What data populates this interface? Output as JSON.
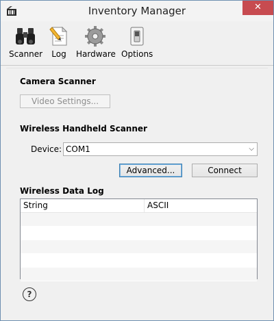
{
  "window": {
    "title": "Inventory Manager",
    "close_label": "✕"
  },
  "toolbar": {
    "scanner": "Scanner",
    "log": "Log",
    "hardware": "Hardware",
    "options": "Options"
  },
  "camera": {
    "title": "Camera Scanner",
    "video_settings": "Video Settings..."
  },
  "wireless": {
    "title": "Wireless Handheld Scanner",
    "device_label": "Device:",
    "device_value": "COM1",
    "advanced": "Advanced...",
    "connect": "Connect"
  },
  "log": {
    "title": "Wireless Data Log",
    "columns": [
      "String",
      "ASCII"
    ],
    "rows": [
      "",
      "",
      "",
      "",
      ""
    ]
  },
  "help": {
    "label": "?"
  }
}
